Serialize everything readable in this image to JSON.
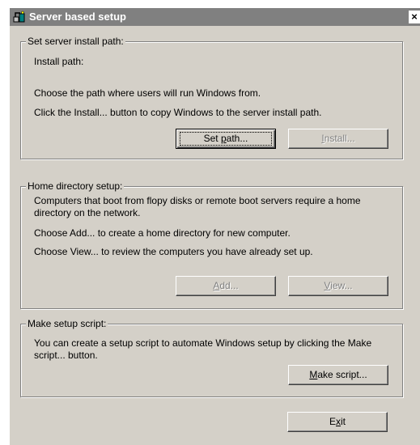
{
  "window": {
    "title": "Server based setup",
    "close_label": "×"
  },
  "install_group": {
    "legend": "Set server install path:",
    "install_path_label": "Install path:",
    "line1": "Choose the path where users will run Windows from.",
    "line2": "Click the Install... button to copy Windows to the server install path.",
    "set_path_pre": "Set ",
    "set_path_u": "p",
    "set_path_post": "ath...",
    "install_u": "I",
    "install_post": "nstall..."
  },
  "home_group": {
    "legend": "Home directory setup:",
    "line1": "Computers that boot from flopy disks or remote boot servers require a home directory on the network.",
    "line2": "Choose Add... to create a home directory for new computer.",
    "line3": "Choose View... to review the computers you have already set up.",
    "add_u": "A",
    "add_post": "dd...",
    "view_u": "V",
    "view_post": "iew..."
  },
  "script_group": {
    "legend": "Make setup script:",
    "line1": "You can create a setup script to automate Windows setup by clicking the Make script... button.",
    "make_u": "M",
    "make_post": "ake script..."
  },
  "footer": {
    "exit_pre": "E",
    "exit_u": "x",
    "exit_post": "it"
  }
}
